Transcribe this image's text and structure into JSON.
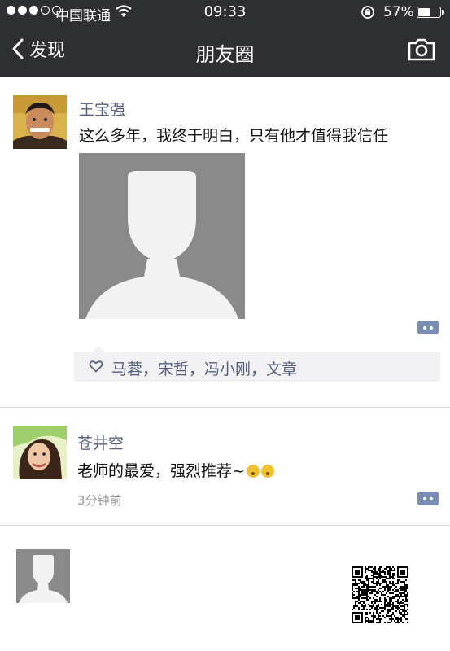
{
  "status_bar": {
    "carrier": "中国联通",
    "time": "09:33",
    "battery": "57%",
    "battery_level": 0.57
  },
  "nav": {
    "back_label": "发现",
    "title": "朋友圈"
  },
  "posts": [
    {
      "name": "王宝强",
      "text": "这么多年，我终于明白，只有他才值得我信任",
      "likes": "马蓉，宋哲，冯小刚，文章"
    },
    {
      "name": "苍井空",
      "text": "老师的最爱，强烈推荐~",
      "time": "3分钟前"
    }
  ],
  "colors": {
    "header_bg": "#2e2f33",
    "name_link": "#56607f",
    "comment_button": "#7a8db5",
    "placeholder_gray": "#8a8a8a"
  },
  "icons": [
    "back-chevron-icon",
    "camera-icon",
    "heart-icon",
    "comment-icon",
    "wifi-icon",
    "battery-icon",
    "qr-code-icon"
  ]
}
